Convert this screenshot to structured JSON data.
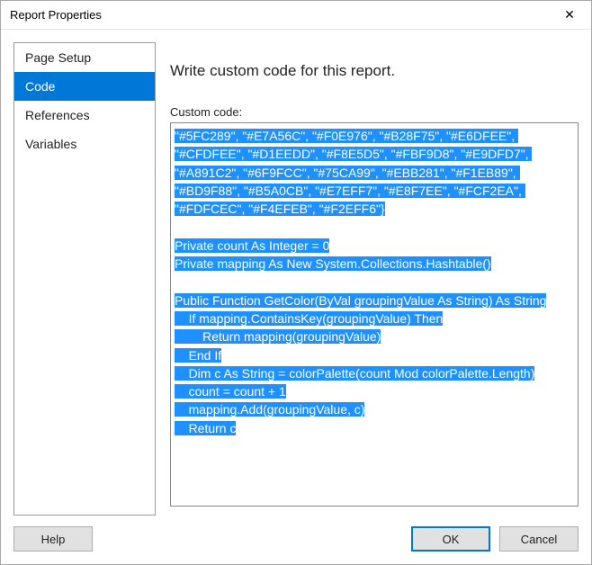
{
  "title": "Report Properties",
  "sidebar": {
    "items": [
      {
        "label": "Page Setup"
      },
      {
        "label": "Code"
      },
      {
        "label": "References"
      },
      {
        "label": "Variables"
      }
    ],
    "active_index": 1
  },
  "main": {
    "instruction": "Write custom code for this report.",
    "code_label": "Custom code:",
    "code_text": "\"#5FC289\", \"#E7A56C\", \"#F0E976\", \"#B28F75\", \"#E6DFEE\", \"#CFDFEE\", \"#D1EEDD\", \"#F8E5D5\", \"#FBF9D8\", \"#E9DFD7\", \"#A891C2\", \"#6F9FCC\", \"#75CA99\", \"#EBB281\", \"#F1EB89\", \"#BD9F88\", \"#B5A0CB\", \"#E7EFF7\", \"#E8F7EE\", \"#FCF2EA\", \"#FDFCEC\", \"#F4EFEB\", \"#F2EFF6\"}\n\nPrivate count As Integer = 0\nPrivate mapping As New System.Collections.Hashtable()\n\nPublic Function GetColor(ByVal groupingValue As String) As String\n    If mapping.ContainsKey(groupingValue) Then\n        Return mapping(groupingValue)\n    End If\n    Dim c As String = colorPalette(count Mod colorPalette.Length)\n    count = count + 1\n    mapping.Add(groupingValue, c)\n    Return c"
  },
  "buttons": {
    "help": "Help",
    "ok": "OK",
    "cancel": "Cancel"
  }
}
